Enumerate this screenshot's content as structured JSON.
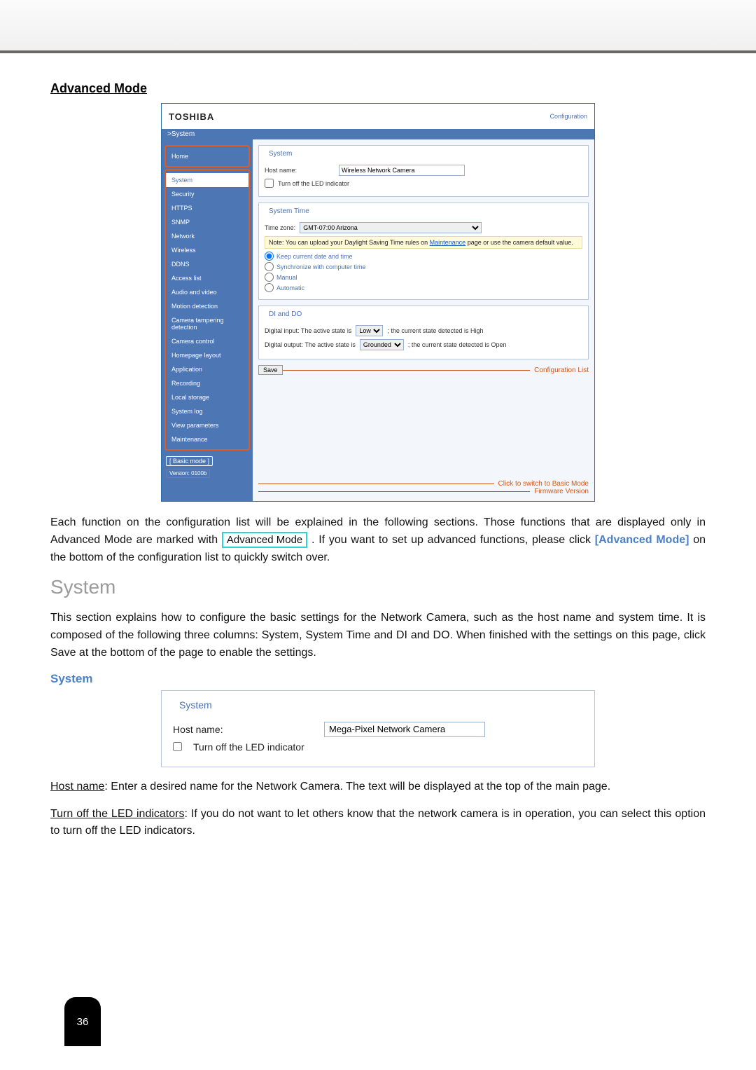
{
  "headings": {
    "advanced_mode": "Advanced Mode",
    "system": "System",
    "system_sub": "System"
  },
  "screenshot": {
    "brand": "TOSHIBA",
    "configuration_link": "Configuration",
    "breadcrumb": ">System",
    "sidebar_group1": [
      "Home"
    ],
    "sidebar_group2_selected": "System",
    "sidebar_group2_rest": [
      "Security",
      "HTTPS",
      "SNMP",
      "Network",
      "Wireless",
      "DDNS",
      "Access list",
      "Audio and video",
      "Motion detection",
      "Camera tampering detection",
      "Camera control",
      "Homepage layout",
      "Application",
      "Recording",
      "Local storage",
      "System log",
      "View parameters",
      "Maintenance"
    ],
    "basic_mode": "[ Basic mode ]",
    "version": "Version: 0100b",
    "system_fieldset": {
      "legend": "System",
      "hostname_label": "Host name:",
      "hostname_value": "Wireless Network Camera",
      "led_label": "Turn off the LED indicator"
    },
    "time_fieldset": {
      "legend": "System Time",
      "tz_label": "Time zone:",
      "tz_value": "GMT-07:00 Arizona",
      "note_pre": "Note: You can upload your Daylight Saving Time rules on ",
      "note_link": "Maintenance",
      "note_post": " page or use the camera default value.",
      "r1": "Keep current date and time",
      "r2": "Synchronize with computer time",
      "r3": "Manual",
      "r4": "Automatic"
    },
    "dido_fieldset": {
      "legend": "DI and DO",
      "di_pre": "Digital input: The active state is",
      "di_sel": "Low",
      "di_post": "; the current state detected is High",
      "do_pre": "Digital output: The active state is",
      "do_sel": "Grounded",
      "do_post": "; the current state detected is Open"
    },
    "save": "Save",
    "labels": {
      "conf_list": "Configuration List",
      "switch_basic": "Click to switch to Basic Mode",
      "fw_version": "Firmware Version"
    }
  },
  "body_text": {
    "para1_pre": "Each function on the configuration list will be explained in the following sections. Those functions that are displayed only in Advanced Mode are marked with ",
    "badge": "Advanced Mode",
    "para1_mid": ". If you want to set up advanced functions, please click ",
    "adv_link": "[Advanced Mode]",
    "para1_post": " on the bottom of the configuration list to quickly switch over.",
    "system_desc": "This section explains how to configure the basic settings for the Network Camera, such as the host name and system time. It is composed of the following three columns: System, System Time and DI and DO. When finished with the settings on this page, click Save at the bottom of the page to enable the settings."
  },
  "panel2": {
    "legend": "System",
    "hostname_label": "Host name:",
    "hostname_value": "Mega-Pixel Network Camera",
    "led_label": "Turn off the LED indicator"
  },
  "defs": {
    "host_name_t": "Host name",
    "host_name_d": ": Enter a desired name for the Network Camera. The text will be displayed at the top of the main page.",
    "led_t": "Turn off the LED indicators",
    "led_d": ": If you do not want to let others know that the network camera is in operation, you can select this option to turn off the LED indicators."
  },
  "page_number": "36"
}
